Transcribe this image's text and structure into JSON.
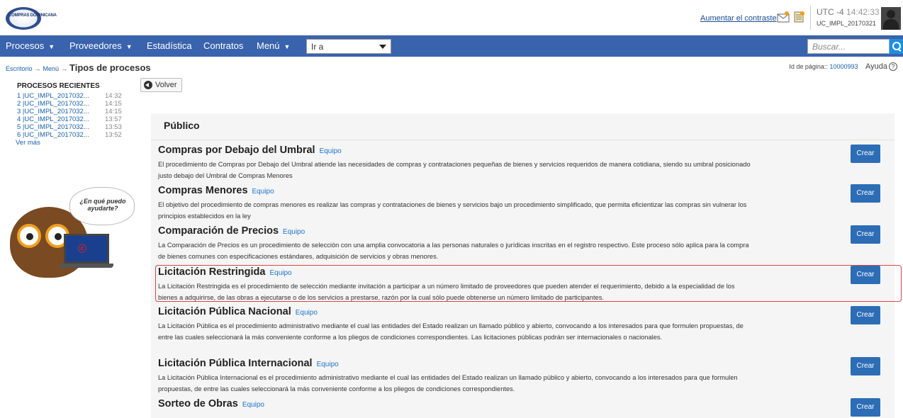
{
  "header": {
    "logo_text": "COMPRAS DOMINICANA",
    "contrast_link": "Aumentar el contraste",
    "mail_icon": "mail-icon",
    "note_icon": "note-icon",
    "timezone": "UTC -4",
    "time": "14:42:33",
    "username": "UC_IMPL_20170321"
  },
  "nav": {
    "items": [
      {
        "label": "Procesos",
        "dropdown": true
      },
      {
        "label": "Proveedores",
        "dropdown": true
      },
      {
        "label": "Estadística",
        "dropdown": false
      },
      {
        "label": "Contratos",
        "dropdown": false
      },
      {
        "label": "Menú",
        "dropdown": true
      }
    ],
    "goto_value": "Ir a",
    "search_placeholder": "Buscar...",
    "bar_color": "#3a63ad"
  },
  "breadcrumb": {
    "escritorio": "Escritorio",
    "menu": "Menú",
    "arrow": "→",
    "current": "Tipos de procesos"
  },
  "page_info": {
    "label": "Id de página::",
    "id": "10000993",
    "help": "Ayuda",
    "help_symbol": "?"
  },
  "sidebar": {
    "recent_title": "PROCESOS RECIENTES",
    "recent": [
      {
        "label": "1 |UC_IMPL_2017032...",
        "time": "14:32"
      },
      {
        "label": "2 |UC_IMPL_2017032...",
        "time": "14:15"
      },
      {
        "label": "3 |UC_IMPL_2017032...",
        "time": "14:15"
      },
      {
        "label": "4 |UC_IMPL_2017032...",
        "time": "13:57"
      },
      {
        "label": "5 |UC_IMPL_2017032...",
        "time": "13:53"
      },
      {
        "label": "6 |UC_IMPL_2017032...",
        "time": "13:52"
      }
    ],
    "ver_mas": "Ver más",
    "help_bubble": "¿En qué puedo ayudarte?"
  },
  "volver_label": "Volver",
  "panel": {
    "title": "Público",
    "create_label": "Crear",
    "team_label": "Equipo",
    "processes": [
      {
        "title": "Compras por Debajo del Umbral",
        "description": "El procedimiento de Compras por Debajo del Umbral atiende las necesidades de compras y contrataciones pequeñas de bienes y servicios requeridos de manera cotidiana, siendo su umbral posicionado justo debajo del Umbral de Compras Menores"
      },
      {
        "title": "Compras Menores",
        "description": "El objetivo del procedimiento de compras menores es realizar las compras y contrataciones de bienes y servicios bajo un procedimiento simplificado, que permita eficientizar las compras sin vulnerar los principios establecidos en la ley"
      },
      {
        "title": "Comparación de Precios",
        "description": "La Comparación de Precios es un procedimiento de selección con una amplia convocatoria a las personas naturales o jurídicas inscritas en el registro respectivo. Este proceso sólo aplica para la compra de bienes comunes con especificaciones estándares, adquisición de servicios y obras menores."
      },
      {
        "title": "Licitación Restringida",
        "description": "La Licitación Restringida es el procedimiento de selección mediante invitación a participar a un número limitado de proveedores que pueden atender el requerimiento, debido a la especialidad de los bienes a adquirirse, de las obras a ejecutarse o de los servicios a prestarse, razón por la cual sólo puede obtenerse un número limitado de participantes.",
        "highlighted": true
      },
      {
        "title": "Licitación Pública Nacional",
        "description": "La Licitación Pública es el procedimiento administrativo mediante el cual las entidades del Estado realizan un llamado público y abierto, convocando a los interesados para que formulen propuestas, de entre las cuales seleccionará la más conveniente conforme a los pliegos de condiciones correspondientes. Las licitaciones públicas podrán ser internacionales o nacionales."
      },
      {
        "title": "Licitación Pública Internacional",
        "description": "La Licitación Pública Internacional es el procedimiento administrativo mediante el cual las entidades del Estado realizan un llamado público y abierto, convocando a los interesados para que formulen propuestas, de entre las cuales seleccionará la más conveniente conforme a los pliegos de condiciones correspondientes."
      },
      {
        "title": "Sorteo de Obras",
        "description": ""
      }
    ]
  }
}
